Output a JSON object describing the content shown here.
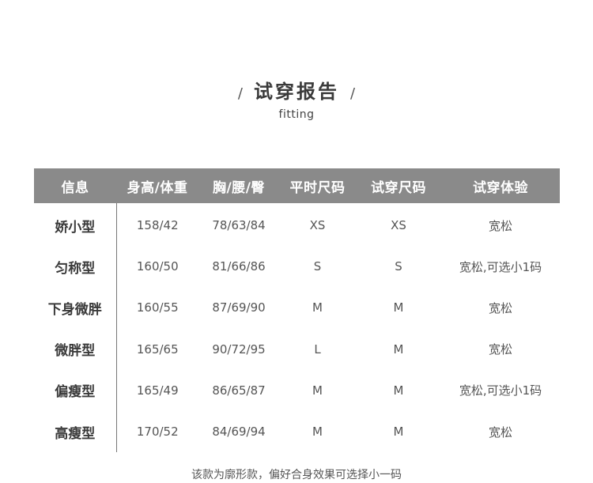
{
  "header": {
    "slash_left": "/",
    "title": "试穿报告",
    "slash_right": "/",
    "subtitle": "fitting"
  },
  "table": {
    "headers": [
      "信息",
      "身高/体重",
      "胸/腰/臀",
      "平时尺码",
      "试穿尺码",
      "试穿体验"
    ],
    "rows": [
      {
        "info": "娇小型",
        "hw": "158/42",
        "bwh": "78/63/84",
        "usual": "XS",
        "try": "XS",
        "exp": "宽松"
      },
      {
        "info": "匀称型",
        "hw": "160/50",
        "bwh": "81/66/86",
        "usual": "S",
        "try": "S",
        "exp": "宽松,可选小1码"
      },
      {
        "info": "下身微胖",
        "hw": "160/55",
        "bwh": "87/69/90",
        "usual": "M",
        "try": "M",
        "exp": "宽松"
      },
      {
        "info": "微胖型",
        "hw": "165/65",
        "bwh": "90/72/95",
        "usual": "L",
        "try": "M",
        "exp": "宽松"
      },
      {
        "info": "偏瘦型",
        "hw": "165/49",
        "bwh": "86/65/87",
        "usual": "M",
        "try": "M",
        "exp": "宽松,可选小1码"
      },
      {
        "info": "高瘦型",
        "hw": "170/52",
        "bwh": "84/69/94",
        "usual": "M",
        "try": "M",
        "exp": "宽松"
      }
    ]
  },
  "footer": {
    "note": "该款为廓形款，偏好合身效果可选择小一码"
  },
  "colors": {
    "header_bg": "#8a8a8a",
    "header_text": "#ffffff",
    "body_text": "#555555",
    "info_text": "#3a3a3a"
  }
}
